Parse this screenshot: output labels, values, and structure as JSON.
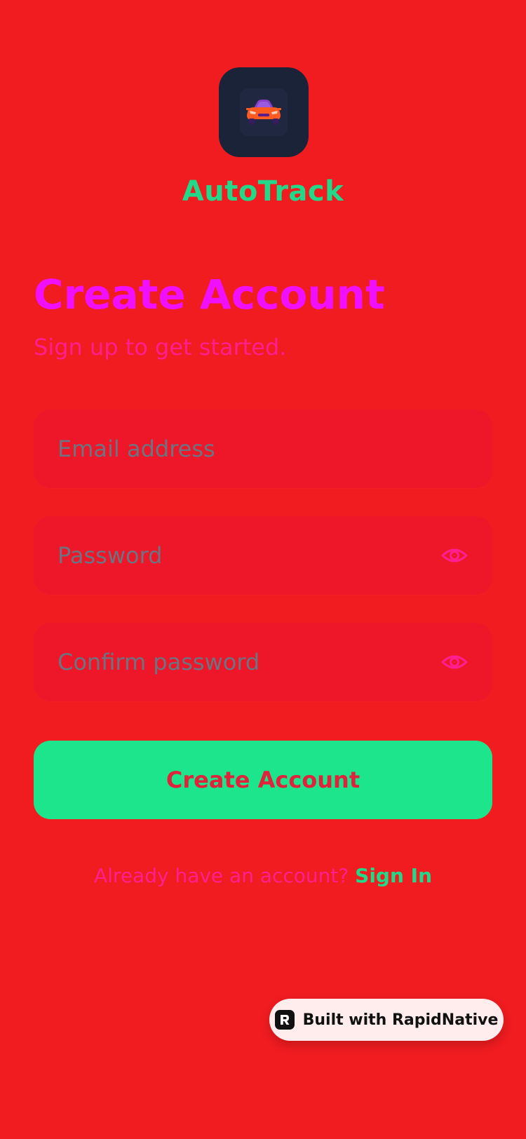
{
  "app": {
    "name": "AutoTrack",
    "logo_icon": "car-icon"
  },
  "header": {
    "title": "Create Account",
    "subtitle": "Sign up to get started."
  },
  "form": {
    "email": {
      "value": "",
      "placeholder": "Email address"
    },
    "password": {
      "value": "",
      "placeholder": "Password",
      "toggle_icon": "eye-icon"
    },
    "confirm_password": {
      "value": "",
      "placeholder": "Confirm password",
      "toggle_icon": "eye-icon"
    },
    "submit_label": "Create Account"
  },
  "footer": {
    "prompt": "Already have an account?",
    "link_label": "Sign In"
  },
  "badge": {
    "label": "Built with RapidNative",
    "icon": "rapidnative-logo-icon"
  },
  "colors": {
    "background": "#f01c20",
    "accent_green": "#1de58b",
    "heading_magenta": "#f010ff",
    "subtitle_pink": "#ff1f8f",
    "field_bg": "#ee1729"
  }
}
